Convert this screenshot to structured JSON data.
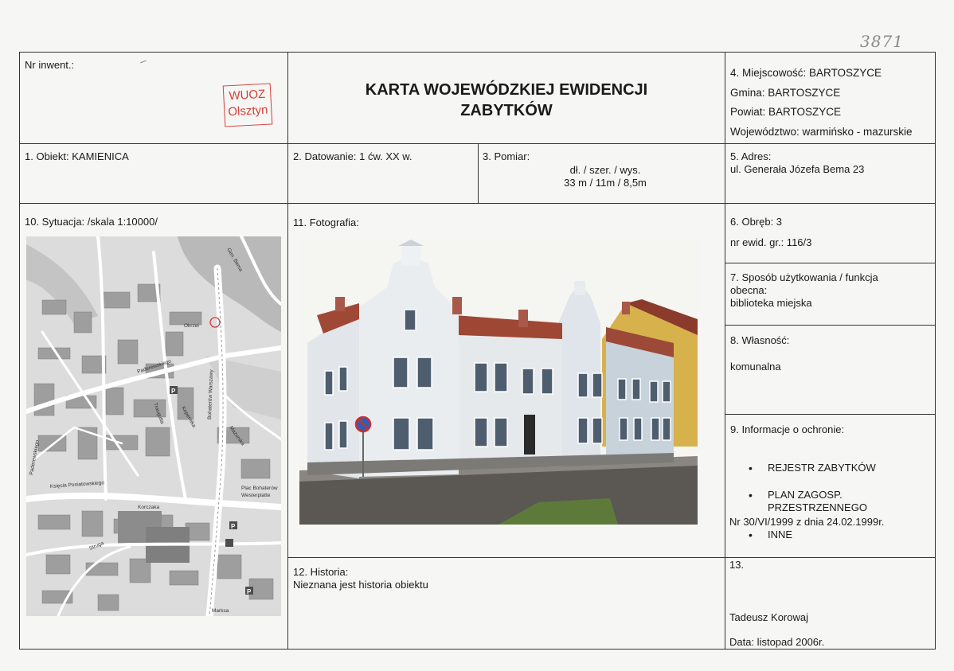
{
  "handwritten_number": "3871",
  "stamp": {
    "line1": "WUOZ",
    "line2": "Olsztyn"
  },
  "header": {
    "inventory_label": "Nr inwent.:",
    "title_line1": "KARTA WOJEWÓDZKIEJ EWIDENCJI",
    "title_line2": "ZABYTKÓW",
    "locality": "4. Miejscowość: BARTOSZYCE",
    "gmina": "Gmina: BARTOSZYCE",
    "powiat": "Powiat: BARTOSZYCE",
    "voivodeship": "Województwo: warmińsko - mazurskie"
  },
  "object": "1. Obiekt: KAMIENICA",
  "dating": "2. Datowanie: 1 ćw. XX w.",
  "measurement": {
    "label": "3. Pomiar:",
    "dims_label": "dł. / szer. / wys.",
    "dims_value": "33 m / 11m / 8,5m"
  },
  "address": {
    "label": "5. Adres:",
    "value": "ul. Generała Józefa Bema 23"
  },
  "situation_label": "10. Sytuacja: /skala 1:10000/",
  "photo_label": "11. Fotografia:",
  "precinct": {
    "label": "6. Obręb: 3",
    "plot": "nr ewid. gr.: 116/3"
  },
  "usage": {
    "label_line1": "7. Sposób użytkowania / funkcja",
    "label_line2": "obecna:",
    "value": "biblioteka miejska"
  },
  "ownership": {
    "label": "8. Własność:",
    "value": "komunalna"
  },
  "protection": {
    "label": "9. Informacje o ochronie:",
    "item1": "REJESTR ZABYTKÓW",
    "item2_line1": "PLAN ZAGOSP.",
    "item2_line2": "PRZESTRZENNEGO",
    "resolution": "Nr 30/VI/1999 z dnia 24.02.1999r.",
    "item3": "INNE"
  },
  "history": {
    "label": "12. Historia:",
    "value": "Nieznana jest historia obiektu"
  },
  "section13": {
    "label": "13.",
    "author": "Tadeusz Korowaj",
    "date": "Data: listopad 2006r."
  },
  "map_labels": {
    "bema": "Gen. Bema",
    "okrzei": "Okrzei",
    "paderewskiego": "Paderewskiego",
    "paderewskiego2": "Paderewskiego",
    "bohaterow": "Bohaterów Warszawy",
    "poniatowskiego": "Księcia Poniatowskiego",
    "plac": "Plac Bohaterów",
    "westerplatte": "Westerplatte",
    "korczaka": "Korczaka",
    "struga": "Struga",
    "marksa": "Marksa",
    "mazurska": "Mazurska",
    "traugutta": "Traugutta",
    "kopernika": "Kopernika"
  }
}
